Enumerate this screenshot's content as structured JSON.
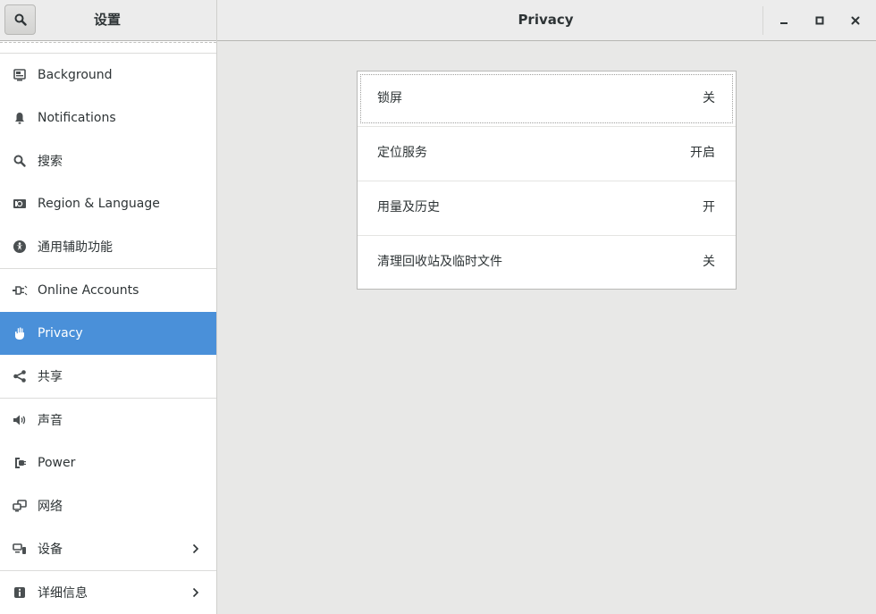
{
  "header": {
    "sidebar_title": "设置",
    "main_title": "Privacy"
  },
  "sidebar": {
    "items": [
      {
        "label": "Background",
        "icon": "background-icon"
      },
      {
        "label": "Notifications",
        "icon": "bell-icon"
      },
      {
        "label": "搜索",
        "icon": "search-icon"
      },
      {
        "label": "Region & Language",
        "icon": "region-flag-icon"
      },
      {
        "label": "通用辅助功能",
        "icon": "accessibility-icon"
      },
      {
        "label": "Online Accounts",
        "icon": "online-accounts-icon"
      },
      {
        "label": "Privacy",
        "icon": "hand-icon",
        "active": true
      },
      {
        "label": "共享",
        "icon": "share-icon"
      },
      {
        "label": "声音",
        "icon": "speaker-icon"
      },
      {
        "label": "Power",
        "icon": "power-plug-icon"
      },
      {
        "label": "网络",
        "icon": "network-icon"
      },
      {
        "label": "设备",
        "icon": "devices-icon",
        "submenu": true
      },
      {
        "label": "详细信息",
        "icon": "info-icon",
        "submenu": true
      }
    ]
  },
  "privacy": {
    "rows": [
      {
        "label": "锁屏",
        "value": "关"
      },
      {
        "label": "定位服务",
        "value": "开启"
      },
      {
        "label": "用量及历史",
        "value": "开"
      },
      {
        "label": "清理回收站及临时文件",
        "value": "关"
      }
    ]
  },
  "colors": {
    "accent": "#4a90d9",
    "background": "#e8e8e7",
    "sidebar": "#ffffff"
  }
}
